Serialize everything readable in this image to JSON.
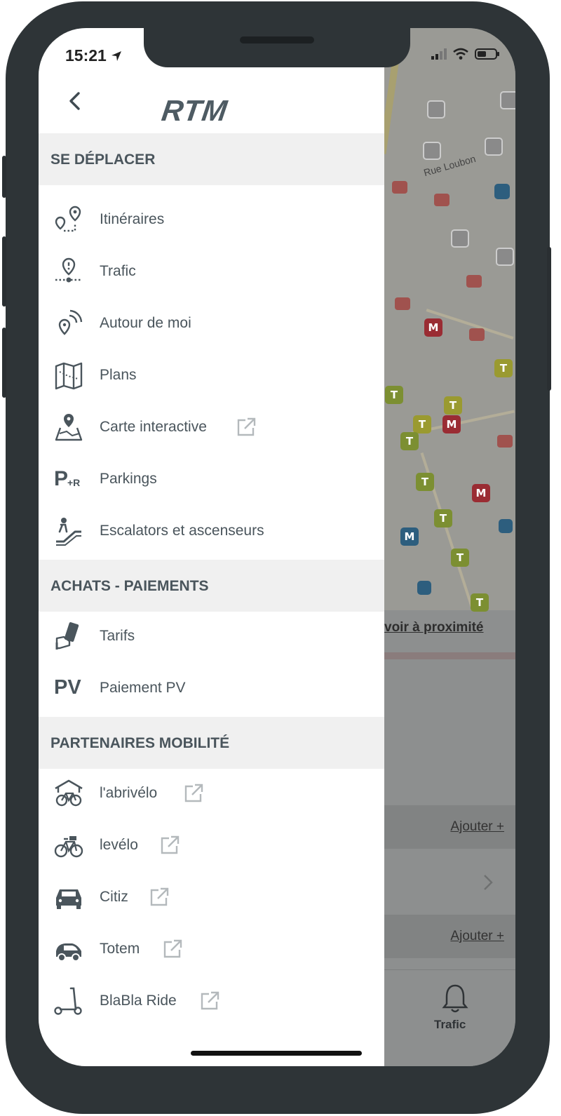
{
  "status": {
    "time": "15:21"
  },
  "header": {
    "logo": "RTM"
  },
  "sections": [
    {
      "title": "SE DÉPLACER"
    },
    {
      "title": "ACHATS - PAIEMENTS"
    },
    {
      "title": "PARTENAIRES MOBILITÉ"
    }
  ],
  "menu": [
    {
      "label": "Itinéraires",
      "icon": "route-icon"
    },
    {
      "label": "Trafic",
      "icon": "traffic-pin-icon"
    },
    {
      "label": "Autour de moi",
      "icon": "nearby-icon"
    },
    {
      "label": "Plans",
      "icon": "map-icon"
    },
    {
      "label": "Carte interactive",
      "icon": "interactive-map-icon"
    },
    {
      "label": "Parkings",
      "icon": "park-ride-icon"
    },
    {
      "label": "Escalators et ascenseurs",
      "icon": "escalator-icon"
    },
    {
      "label": "Tarifs",
      "icon": "ticket-icon"
    },
    {
      "label": "Paiement PV",
      "icon": "pv-icon",
      "icon_text": "PV"
    },
    {
      "label": "l'abrivélo",
      "icon": "bike-shelter-icon"
    },
    {
      "label": "levélo",
      "icon": "bike-icon"
    },
    {
      "label": "Citiz",
      "icon": "car-icon"
    },
    {
      "label": "Totem",
      "icon": "small-car-icon"
    },
    {
      "label": "BlaBla Ride",
      "icon": "scooter-icon"
    }
  ],
  "parking_icon_text": {
    "p": "P",
    "sub": "+R"
  },
  "background": {
    "street": "Rue Loubon",
    "link": "voir à proximité",
    "ajouter_1": "Ajouter +",
    "ajouter_2": "Ajouter +",
    "tab_label": "Trafic"
  },
  "colors": {
    "text": "#4a555c",
    "section_bg": "#f0f0f0",
    "phone": "#2e3437"
  }
}
